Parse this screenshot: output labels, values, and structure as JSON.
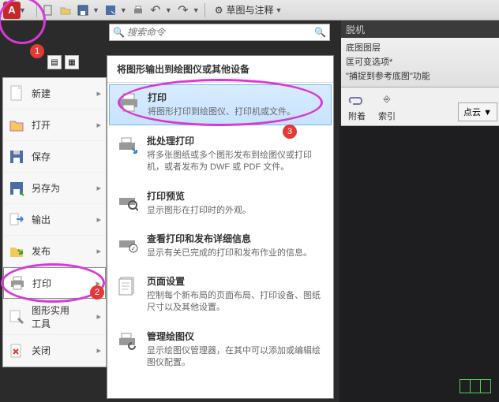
{
  "titlebar": {
    "logo": "A",
    "workspace_label": "草图与注释"
  },
  "search": {
    "placeholder": "搜索命令"
  },
  "right_panel": {
    "tab": "脱机",
    "line1a": "底图图层",
    "line1b": "匡可变选项*",
    "line2": "\"捕捉到参考底图\"功能",
    "attach": "附着",
    "index": "索引",
    "cloud": "点云 ▼"
  },
  "app_menu": {
    "items": [
      {
        "label": "新建"
      },
      {
        "label": "打开"
      },
      {
        "label": "保存"
      },
      {
        "label": "另存为"
      },
      {
        "label": "输出"
      },
      {
        "label": "发布"
      },
      {
        "label": "打印"
      },
      {
        "label": "图形实用\n工具"
      },
      {
        "label": "关闭"
      }
    ]
  },
  "submenu": {
    "heading": "将图形输出到绘图仪或其他设备",
    "items": [
      {
        "title": "打印",
        "desc": "将图形打印到绘图仪、打印机或文件。"
      },
      {
        "title": "批处理打印",
        "desc": "将多张图纸或多个图形发布到绘图仪或打印机，或者发布为 DWF 或 PDF 文件。"
      },
      {
        "title": "打印预览",
        "desc": "显示图形在打印时的外观。"
      },
      {
        "title": "查看打印和发布详细信息",
        "desc": "显示有关已完成的打印和发布作业的信息。"
      },
      {
        "title": "页面设置",
        "desc": "控制每个新布局的页面布局、打印设备、图纸尺寸以及其他设置。"
      },
      {
        "title": "管理绘图仪",
        "desc": "显示绘图仪管理器，在其中可以添加或编辑绘图仪配置。"
      }
    ]
  },
  "badges": {
    "b1": "1",
    "b2": "2",
    "b3": "3"
  }
}
